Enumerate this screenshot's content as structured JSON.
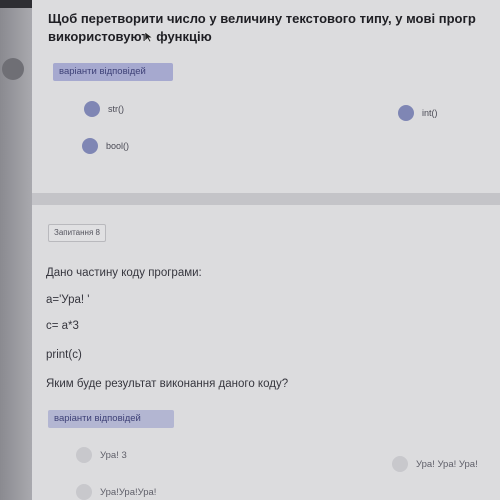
{
  "question1": {
    "title_line1": "Щоб перетворити число у величину текстового типу, у мові прогр",
    "title_line2_a": "використовуют",
    "title_line2_b": "функцію",
    "answers_tag": "варіанти відповідей",
    "options": [
      "str()",
      "int()",
      "bool()"
    ]
  },
  "question2": {
    "number_label": "Запитання 8",
    "lines": [
      "Дано частину коду програми:",
      "a='Ура! '",
      "c= a*3",
      "print(c)",
      "Яким буде результат виконання даного коду?"
    ],
    "answers_tag": "варіанти відповідей",
    "options": [
      "Ура! 3",
      "Ура! Ура! Ура!",
      "Ура!Ура!Ура!"
    ]
  },
  "colors": {
    "radio_active": "#7f86b4",
    "tag_background": "#a6a9cf",
    "text_dark": "#1f1f24"
  },
  "icons": [
    "mouse-cursor-icon"
  ]
}
